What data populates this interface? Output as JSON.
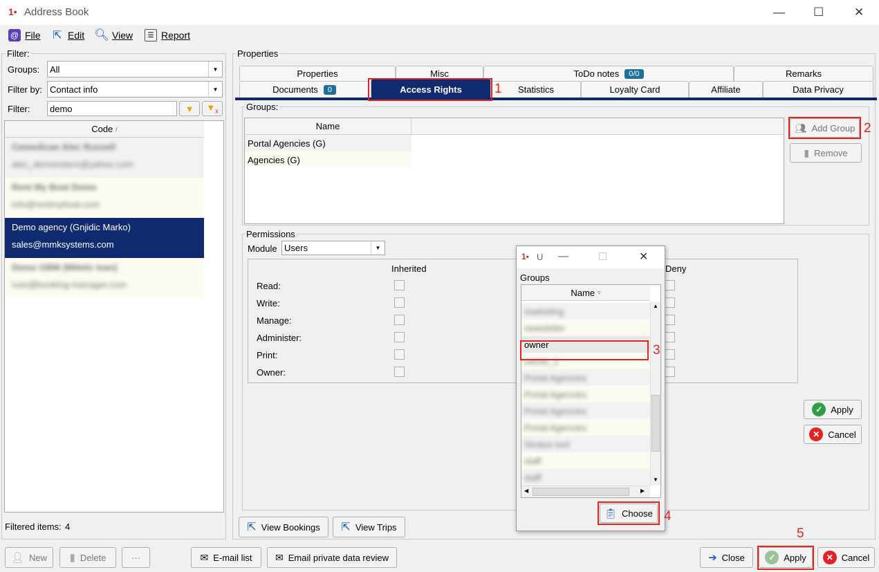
{
  "window": {
    "title": "Address Book"
  },
  "menu": {
    "file": "File",
    "edit": "Edit",
    "view": "View",
    "report": "Report"
  },
  "filter": {
    "legend": "Filter:",
    "groups_label": "Groups:",
    "groups_value": "All",
    "filterby_label": "Filter by:",
    "filterby_value": "Contact info",
    "filter_label": "Filter:",
    "filter_value": "demo"
  },
  "list": {
    "column": "Code",
    "items": [
      {
        "name": "Cemedican Alec Russell",
        "email": "alec_demonsters@yahoo.com"
      },
      {
        "name": "Rent My Boat Demo",
        "email": "info@rentmyboat.com"
      },
      {
        "name": "Demo agency (Gnjidic Marko)",
        "email": "sales@mmksystems.com"
      },
      {
        "name": "Demo GBM (Miletic Ivan)",
        "email": "ivan@booking-manager.com"
      }
    ],
    "filtered_label": "Filtered items:",
    "filtered_count": "4"
  },
  "properties": {
    "legend": "Properties",
    "tabs_row1": [
      "Properties",
      "Misc",
      "ToDo notes",
      "Remarks"
    ],
    "todo_badge": "0/0",
    "tabs_row2": [
      "Documents",
      "Access Rights",
      "Statistics",
      "Loyalty Card",
      "Affiliate",
      "Data Privacy"
    ],
    "documents_badge": "0",
    "groups_legend": "Groups:",
    "groups_column": "Name",
    "groups": [
      "Portal Agencies (G)",
      "Agencies (G)"
    ],
    "add_group": "Add Group",
    "remove": "Remove",
    "permissions_legend": "Permissions",
    "module_label": "Module",
    "module_value": "Users",
    "inherited_label": "Inherited",
    "deny_label": "Deny",
    "perms": [
      "Read:",
      "Write:",
      "Manage:",
      "Administer:",
      "Print:",
      "Owner:"
    ],
    "apply": "Apply",
    "cancel": "Cancel",
    "view_bookings": "View Bookings",
    "view_trips": "View Trips"
  },
  "dialog": {
    "title": "U",
    "groups_label": "Groups",
    "column": "Name",
    "items": [
      "marketing",
      "newsletter",
      "owner",
      "owner_1",
      "Portal Agencies",
      "Portal Agencies",
      "Portal Agencies",
      "Portal Agencies",
      "Stratus tool",
      "staff",
      "staff"
    ],
    "choose": "Choose"
  },
  "bottom": {
    "new": "New",
    "delete": "Delete",
    "more": "···",
    "email_list": "E-mail list",
    "email_private": "Email private data review",
    "close": "Close",
    "apply": "Apply",
    "cancel": "Cancel"
  },
  "annotations": [
    "1",
    "2",
    "3",
    "4",
    "5"
  ],
  "colors": {
    "selection": "#0f2a6e",
    "annotation": "#e02424",
    "accent": "#1f6f9b"
  }
}
